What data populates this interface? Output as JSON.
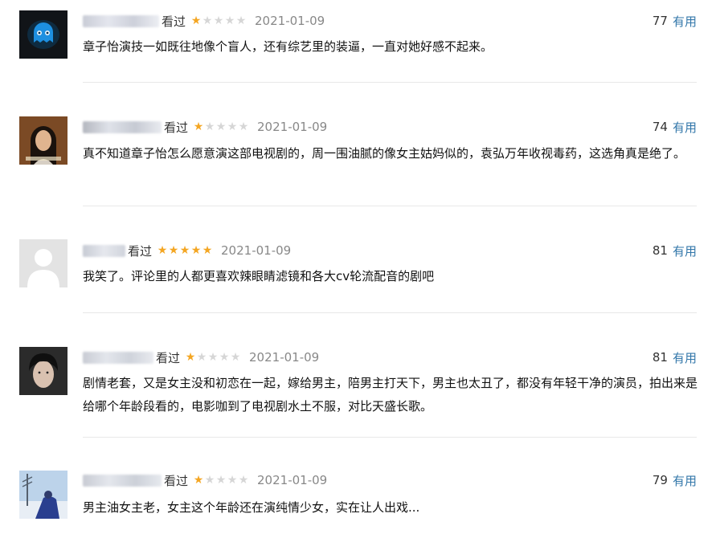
{
  "reviews": [
    {
      "status": "看过",
      "rating": 1,
      "date": "2021-01-09",
      "votes": "77",
      "useful_label": "有用",
      "content": "章子怡演技一如既往地像个盲人，还有综艺里的装逼，一直对她好感不起来。"
    },
    {
      "status": "看过",
      "rating": 1,
      "date": "2021-01-09",
      "votes": "74",
      "useful_label": "有用",
      "content": "真不知道章子怡怎么愿意演这部电视剧的，周一围油腻的像女主姑妈似的，袁弘万年收视毒药，这选角真是绝了。"
    },
    {
      "status": "看过",
      "rating": 5,
      "date": "2021-01-09",
      "votes": "81",
      "useful_label": "有用",
      "content": "我笑了。评论里的人都更喜欢辣眼睛滤镜和各大cv轮流配音的剧吧"
    },
    {
      "status": "看过",
      "rating": 1,
      "date": "2021-01-09",
      "votes": "81",
      "useful_label": "有用",
      "content": "剧情老套，又是女主没和初恋在一起，嫁给男主，陪男主打天下，男主也太丑了，都没有年轻干净的演员，拍出来是给哪个年龄段看的，电影咖到了电视剧水土不服，对比天盛长歌。"
    },
    {
      "status": "看过",
      "rating": 1,
      "date": "2021-01-09",
      "votes": "79",
      "useful_label": "有用",
      "content": "男主油女主老，女主这个年龄还在演纯情少女，实在让人出戏..."
    }
  ],
  "colors": {
    "star_on": "#f4a623",
    "star_off": "#d6d6d6",
    "link": "#3377aa",
    "date": "#888888"
  }
}
